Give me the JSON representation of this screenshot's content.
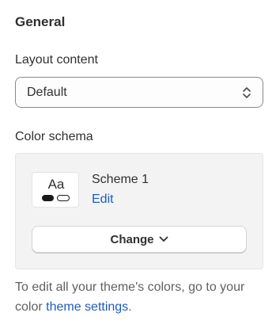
{
  "section": {
    "title": "General"
  },
  "layout_content": {
    "label": "Layout content",
    "selected": "Default"
  },
  "color_schema": {
    "label": "Color schema",
    "swatch_text": "Aa",
    "scheme_name": "Scheme 1",
    "edit_label": "Edit",
    "change_label": "Change"
  },
  "help": {
    "text_before": "To edit all your theme's colors, go to your color ",
    "link_text": "theme settings",
    "text_after": "."
  },
  "colors": {
    "link": "#1f5bbf",
    "text": "#303030",
    "muted_text": "#616161",
    "card_background": "#f3f3f3"
  },
  "icons": {
    "select": "select-chevrons-icon",
    "change": "chevron-down-icon"
  }
}
